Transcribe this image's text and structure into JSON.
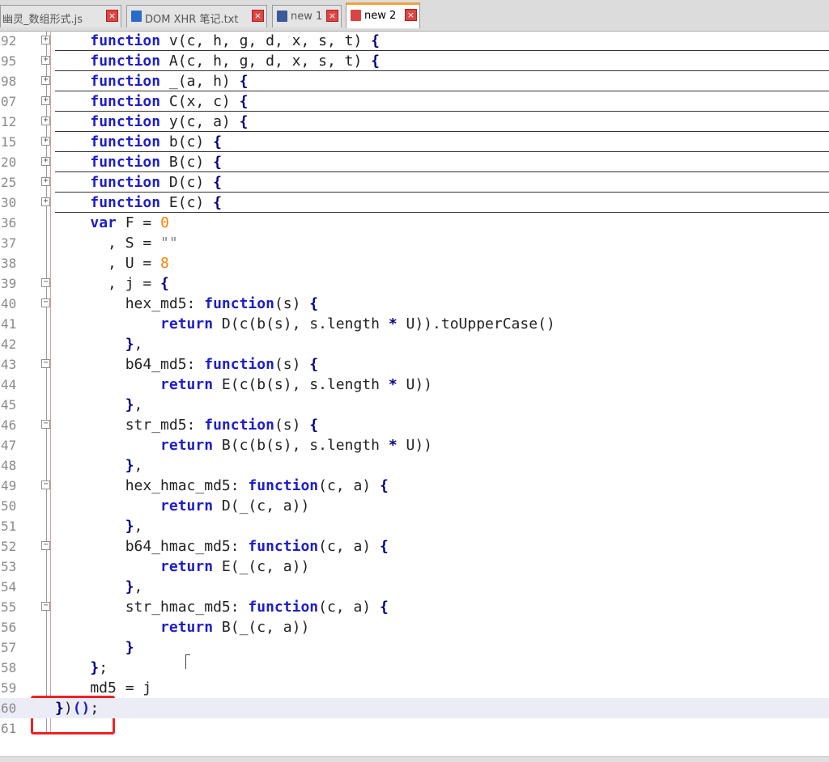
{
  "tabs": [
    {
      "label": "幽灵_数组形式.js",
      "icon": "js-file-icon",
      "active": false,
      "icon_color": "#4a7fc0"
    },
    {
      "label": "DOM XHR 笔记.txt",
      "icon": "saved-file-icon",
      "active": false,
      "icon_color": "#2a6ac8"
    },
    {
      "label": "new 1",
      "icon": "saved-file-icon",
      "active": false,
      "icon_color": "#3a5a9a"
    },
    {
      "label": "new 2",
      "icon": "unsaved-file-icon",
      "active": true,
      "icon_color": "#d94444"
    }
  ],
  "colors": {
    "keyword": "#1e1ec8",
    "number": "#ff8000",
    "string": "#808080",
    "highlight_box": "#ee2222",
    "current_line": "#ececf7"
  },
  "lines": [
    {
      "num": "92",
      "fold": "plus",
      "collapsed": true,
      "tokens": [
        {
          "t": "    "
        },
        {
          "t": "function",
          "c": "kw"
        },
        {
          "t": " v(c, h, g, d, x, s, t) "
        },
        {
          "t": "{",
          "c": "op"
        }
      ]
    },
    {
      "num": "95",
      "fold": "plus",
      "collapsed": true,
      "tokens": [
        {
          "t": "    "
        },
        {
          "t": "function",
          "c": "kw"
        },
        {
          "t": " A(c, h, g, d, x, s, t) "
        },
        {
          "t": "{",
          "c": "op"
        }
      ]
    },
    {
      "num": "98",
      "fold": "plus",
      "collapsed": true,
      "tokens": [
        {
          "t": "    "
        },
        {
          "t": "function",
          "c": "kw"
        },
        {
          "t": " _(a, h) "
        },
        {
          "t": "{",
          "c": "op"
        }
      ]
    },
    {
      "num": "07",
      "fold": "plus",
      "collapsed": true,
      "tokens": [
        {
          "t": "    "
        },
        {
          "t": "function",
          "c": "kw"
        },
        {
          "t": " C(x, c) "
        },
        {
          "t": "{",
          "c": "op"
        }
      ]
    },
    {
      "num": "12",
      "fold": "plus",
      "collapsed": true,
      "tokens": [
        {
          "t": "    "
        },
        {
          "t": "function",
          "c": "kw"
        },
        {
          "t": " y(c, a) "
        },
        {
          "t": "{",
          "c": "op"
        }
      ]
    },
    {
      "num": "15",
      "fold": "plus",
      "collapsed": true,
      "tokens": [
        {
          "t": "    "
        },
        {
          "t": "function",
          "c": "kw"
        },
        {
          "t": " b(c) "
        },
        {
          "t": "{",
          "c": "op"
        }
      ]
    },
    {
      "num": "20",
      "fold": "plus",
      "collapsed": true,
      "tokens": [
        {
          "t": "    "
        },
        {
          "t": "function",
          "c": "kw"
        },
        {
          "t": " B(c) "
        },
        {
          "t": "{",
          "c": "op"
        }
      ]
    },
    {
      "num": "25",
      "fold": "plus",
      "collapsed": true,
      "tokens": [
        {
          "t": "    "
        },
        {
          "t": "function",
          "c": "kw"
        },
        {
          "t": " D(c) "
        },
        {
          "t": "{",
          "c": "op"
        }
      ]
    },
    {
      "num": "30",
      "fold": "plus",
      "collapsed": true,
      "tokens": [
        {
          "t": "    "
        },
        {
          "t": "function",
          "c": "kw"
        },
        {
          "t": " E(c) "
        },
        {
          "t": "{",
          "c": "op"
        }
      ]
    },
    {
      "num": "36",
      "fold": "",
      "collapsed": false,
      "tokens": [
        {
          "t": "    "
        },
        {
          "t": "var",
          "c": "kw"
        },
        {
          "t": " F = "
        },
        {
          "t": "0",
          "c": "num"
        }
      ]
    },
    {
      "num": "37",
      "fold": "",
      "collapsed": false,
      "tokens": [
        {
          "t": "      , S = "
        },
        {
          "t": "\"\"",
          "c": "str"
        }
      ]
    },
    {
      "num": "38",
      "fold": "",
      "collapsed": false,
      "tokens": [
        {
          "t": "      , U = "
        },
        {
          "t": "8",
          "c": "num"
        }
      ]
    },
    {
      "num": "39",
      "fold": "minus",
      "collapsed": false,
      "tokens": [
        {
          "t": "      , j = "
        },
        {
          "t": "{",
          "c": "op"
        }
      ]
    },
    {
      "num": "40",
      "fold": "minus",
      "collapsed": false,
      "tokens": [
        {
          "t": "        hex_md5: "
        },
        {
          "t": "function",
          "c": "kw"
        },
        {
          "t": "(s) "
        },
        {
          "t": "{",
          "c": "op"
        }
      ]
    },
    {
      "num": "41",
      "fold": "",
      "collapsed": false,
      "tokens": [
        {
          "t": "            "
        },
        {
          "t": "return",
          "c": "kw"
        },
        {
          "t": " D(c(b(s), s.length "
        },
        {
          "t": "*",
          "c": "op"
        },
        {
          "t": " U)).toUpperCase()"
        }
      ]
    },
    {
      "num": "42",
      "fold": "",
      "collapsed": false,
      "tokens": [
        {
          "t": "        "
        },
        {
          "t": "}",
          "c": "op"
        },
        {
          "t": ","
        }
      ]
    },
    {
      "num": "43",
      "fold": "minus",
      "collapsed": false,
      "tokens": [
        {
          "t": "        b64_md5: "
        },
        {
          "t": "function",
          "c": "kw"
        },
        {
          "t": "(s) "
        },
        {
          "t": "{",
          "c": "op"
        }
      ]
    },
    {
      "num": "44",
      "fold": "",
      "collapsed": false,
      "tokens": [
        {
          "t": "            "
        },
        {
          "t": "return",
          "c": "kw"
        },
        {
          "t": " E(c(b(s), s.length "
        },
        {
          "t": "*",
          "c": "op"
        },
        {
          "t": " U))"
        }
      ]
    },
    {
      "num": "45",
      "fold": "",
      "collapsed": false,
      "tokens": [
        {
          "t": "        "
        },
        {
          "t": "}",
          "c": "op"
        },
        {
          "t": ","
        }
      ]
    },
    {
      "num": "46",
      "fold": "minus",
      "collapsed": false,
      "tokens": [
        {
          "t": "        str_md5: "
        },
        {
          "t": "function",
          "c": "kw"
        },
        {
          "t": "(s) "
        },
        {
          "t": "{",
          "c": "op"
        }
      ]
    },
    {
      "num": "47",
      "fold": "",
      "collapsed": false,
      "tokens": [
        {
          "t": "            "
        },
        {
          "t": "return",
          "c": "kw"
        },
        {
          "t": " B(c(b(s), s.length "
        },
        {
          "t": "*",
          "c": "op"
        },
        {
          "t": " U))"
        }
      ]
    },
    {
      "num": "48",
      "fold": "",
      "collapsed": false,
      "tokens": [
        {
          "t": "        "
        },
        {
          "t": "}",
          "c": "op"
        },
        {
          "t": ","
        }
      ]
    },
    {
      "num": "49",
      "fold": "minus",
      "collapsed": false,
      "tokens": [
        {
          "t": "        hex_hmac_md5: "
        },
        {
          "t": "function",
          "c": "kw"
        },
        {
          "t": "(c, a) "
        },
        {
          "t": "{",
          "c": "op"
        }
      ]
    },
    {
      "num": "50",
      "fold": "",
      "collapsed": false,
      "tokens": [
        {
          "t": "            "
        },
        {
          "t": "return",
          "c": "kw"
        },
        {
          "t": " D(_(c, a))"
        }
      ]
    },
    {
      "num": "51",
      "fold": "",
      "collapsed": false,
      "tokens": [
        {
          "t": "        "
        },
        {
          "t": "}",
          "c": "op"
        },
        {
          "t": ","
        }
      ]
    },
    {
      "num": "52",
      "fold": "minus",
      "collapsed": false,
      "tokens": [
        {
          "t": "        b64_hmac_md5: "
        },
        {
          "t": "function",
          "c": "kw"
        },
        {
          "t": "(c, a) "
        },
        {
          "t": "{",
          "c": "op"
        }
      ]
    },
    {
      "num": "53",
      "fold": "",
      "collapsed": false,
      "tokens": [
        {
          "t": "            "
        },
        {
          "t": "return",
          "c": "kw"
        },
        {
          "t": " E(_(c, a))"
        }
      ]
    },
    {
      "num": "54",
      "fold": "",
      "collapsed": false,
      "tokens": [
        {
          "t": "        "
        },
        {
          "t": "}",
          "c": "op"
        },
        {
          "t": ","
        }
      ]
    },
    {
      "num": "55",
      "fold": "minus",
      "collapsed": false,
      "tokens": [
        {
          "t": "        str_hmac_md5: "
        },
        {
          "t": "function",
          "c": "kw"
        },
        {
          "t": "(c, a) "
        },
        {
          "t": "{",
          "c": "op"
        }
      ]
    },
    {
      "num": "56",
      "fold": "",
      "collapsed": false,
      "tokens": [
        {
          "t": "            "
        },
        {
          "t": "return",
          "c": "kw"
        },
        {
          "t": " B(_(c, a))"
        }
      ]
    },
    {
      "num": "57",
      "fold": "",
      "collapsed": false,
      "tokens": [
        {
          "t": "        "
        },
        {
          "t": "}",
          "c": "op"
        }
      ]
    },
    {
      "num": "58",
      "fold": "",
      "collapsed": false,
      "tokens": [
        {
          "t": "    "
        },
        {
          "t": "}",
          "c": "op"
        },
        {
          "t": ";"
        }
      ]
    },
    {
      "num": "59",
      "fold": "",
      "collapsed": false,
      "tokens": [
        {
          "t": "    md5 = j"
        }
      ]
    },
    {
      "num": "60",
      "fold": "",
      "collapsed": false,
      "current": true,
      "tokens": [
        {
          "t": "}",
          "c": "op"
        },
        {
          "t": ")"
        },
        {
          "t": "()",
          "c": "kw"
        },
        {
          "t": ";"
        }
      ]
    },
    {
      "num": "61",
      "fold": "",
      "collapsed": false,
      "tokens": []
    }
  ]
}
